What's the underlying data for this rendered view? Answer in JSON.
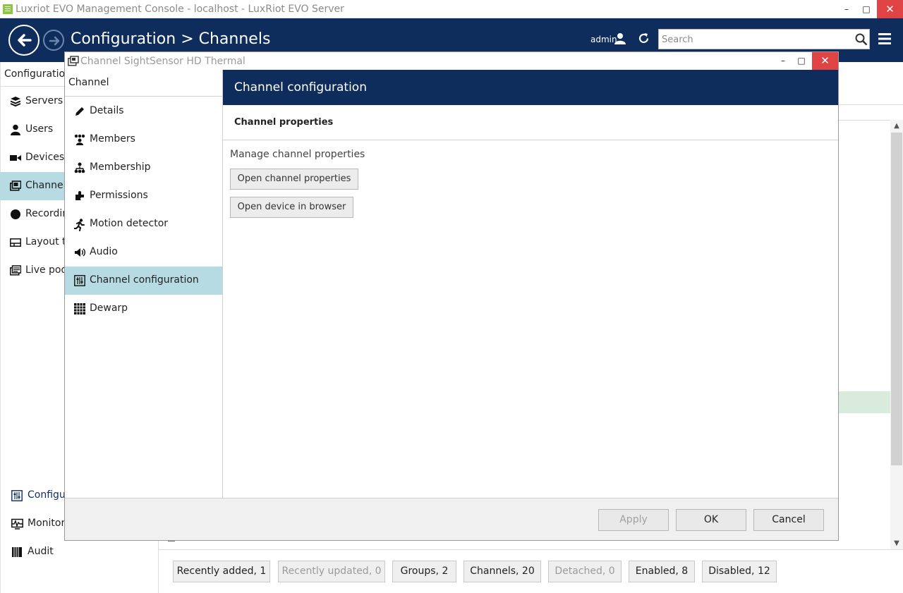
{
  "window": {
    "title": "Luxriot EVO Management Console - localhost - LuxRiot EVO Server",
    "minimize": "–",
    "maximize": "□",
    "close": "✕"
  },
  "header": {
    "title": "Configuration > Channels",
    "user": "admin",
    "search_placeholder": "Search",
    "color": "#0e2d5c"
  },
  "background_sidebar": {
    "tab": "Configuration",
    "items": [
      {
        "label": "Servers",
        "icon": "servers-icon"
      },
      {
        "label": "Users",
        "icon": "user-icon"
      },
      {
        "label": "Devices",
        "icon": "camera-icon"
      },
      {
        "label": "Channels",
        "icon": "channel-icon",
        "active": true
      },
      {
        "label": "Recording",
        "icon": "record-icon"
      },
      {
        "label": "Layout te",
        "icon": "layout-icon"
      },
      {
        "label": "Live podc",
        "icon": "live-icon"
      }
    ],
    "bottom": [
      {
        "label": "Configur",
        "icon": "configuration-icon"
      },
      {
        "label": "Monitorin",
        "icon": "monitoring-icon"
      },
      {
        "label": "Audit",
        "icon": "audit-icon"
      }
    ]
  },
  "filters": [
    {
      "label": "Recently added, 1",
      "disabled": false
    },
    {
      "label": "Recently updated, 0",
      "disabled": true
    },
    {
      "label": "Groups, 2",
      "disabled": false
    },
    {
      "label": "Channels, 20",
      "disabled": false
    },
    {
      "label": "Detached, 0",
      "disabled": true
    },
    {
      "label": "Enabled, 8",
      "disabled": false
    },
    {
      "label": "Disabled, 12",
      "disabled": false
    }
  ],
  "dialog": {
    "title": "Channel SightSensor HD Thermal",
    "sidebar_header": "Channel",
    "items": [
      {
        "label": "Details",
        "icon": "pencil-icon"
      },
      {
        "label": "Members",
        "icon": "members-icon"
      },
      {
        "label": "Membership",
        "icon": "membership-icon"
      },
      {
        "label": "Permissions",
        "icon": "permissions-icon"
      },
      {
        "label": "Motion detector",
        "icon": "motion-icon"
      },
      {
        "label": "Audio",
        "icon": "speaker-icon"
      },
      {
        "label": "Channel configuration",
        "icon": "channel-config-icon",
        "active": true
      },
      {
        "label": "Dewarp",
        "icon": "dewarp-icon"
      }
    ],
    "main_header": "Channel configuration",
    "section_title": "Channel properties",
    "manage_label": "Manage channel properties",
    "open_props": "Open channel properties",
    "open_browser": "Open device in browser",
    "apply": "Apply",
    "ok": "OK",
    "cancel": "Cancel"
  },
  "colors": {
    "active_item": "#b7dbe2",
    "close_button": "#e04343"
  }
}
